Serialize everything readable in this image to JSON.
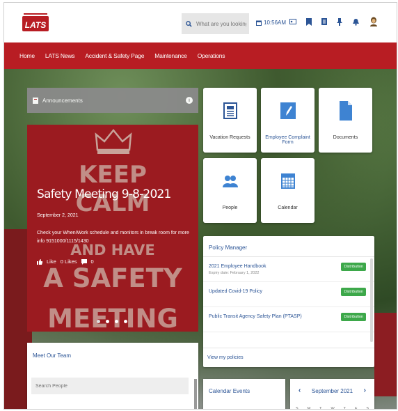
{
  "header": {
    "logo_text": "LATS",
    "search_placeholder": "What are you looking for?",
    "time": "10:56AM"
  },
  "nav": [
    "Home",
    "LATS News",
    "Accident & Safety Page",
    "Maintenance",
    "Operations"
  ],
  "announcements": {
    "label": "Announcements",
    "poster_lines": [
      "KEEP",
      "CALM",
      "AND HAVE",
      "A SAFETY",
      "MEETING"
    ],
    "title": "Safety Meeting 9-8-2021",
    "date": "September 2, 2021",
    "text": "Check your WhenIWork schedule and monitors in break room for more info 9151000/1115/1430",
    "like_label": "Like",
    "likes": "0 Likes",
    "comments": "0"
  },
  "tiles": [
    {
      "label": "Vacation Requests",
      "icon": "news-icon"
    },
    {
      "label": "Employee Complaint Form",
      "icon": "pencil-icon"
    },
    {
      "label": "Documents",
      "icon": "document-icon"
    },
    {
      "label": "People",
      "icon": "people-icon"
    },
    {
      "label": "Calendar",
      "icon": "calendar-icon"
    }
  ],
  "policy": {
    "title": "Policy Manager",
    "items": [
      {
        "name": "2021 Employee Handbook",
        "expiry": "Expiry date: February 1, 2022",
        "status": "Distribution"
      },
      {
        "name": "Updated Covid-19 Policy",
        "expiry": "",
        "status": "Distribution"
      },
      {
        "name": "Public Transit Agency Safety Plan (PTASP)",
        "expiry": "",
        "status": "Distribution"
      }
    ],
    "footer": "View my policies"
  },
  "team": {
    "title": "Meet Our Team",
    "search_placeholder": "Search People"
  },
  "calendar_events": {
    "title": "Calendar Events"
  },
  "calendar": {
    "month": "September 2021",
    "prev": "‹",
    "next": "›",
    "days": [
      "S",
      "M",
      "T",
      "W",
      "T",
      "F",
      "S"
    ]
  },
  "colors": {
    "brand_red": "#b81d23",
    "link_blue": "#2c5596",
    "badge_green": "#3da84a"
  }
}
